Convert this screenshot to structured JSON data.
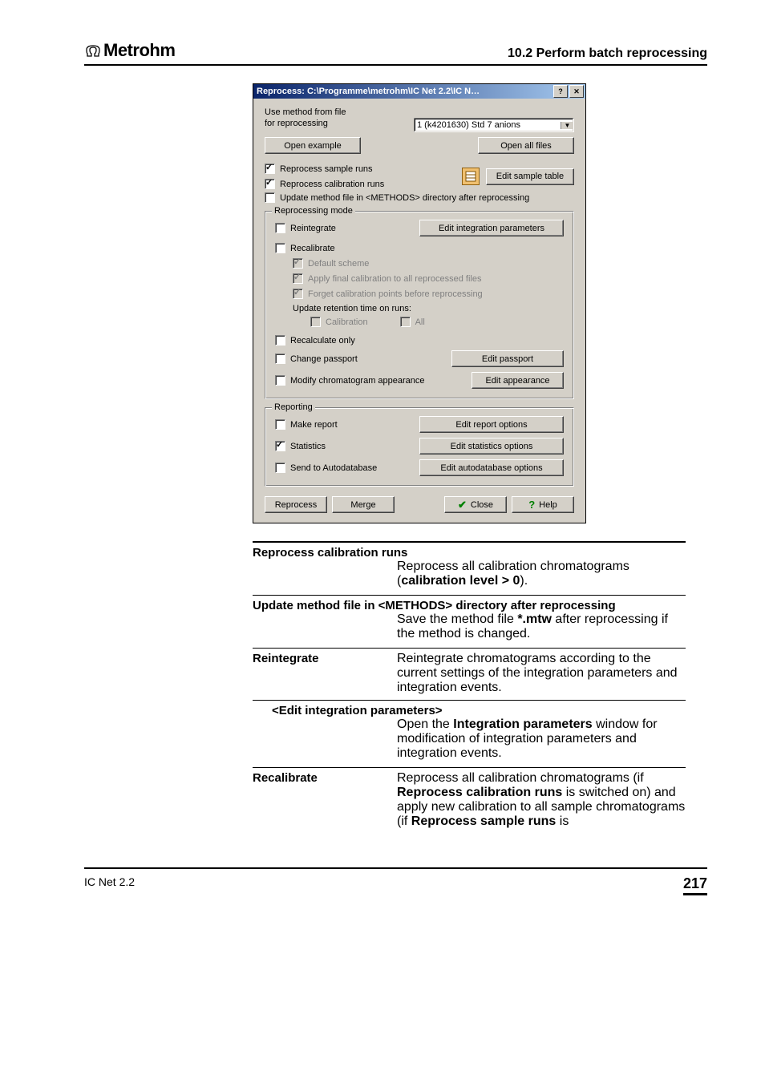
{
  "header": {
    "brand": "Metrohm",
    "section": "10.2  Perform batch reprocessing"
  },
  "dialog": {
    "title": "Reprocess: C:\\Programme\\metrohm\\IC Net 2.2\\IC N…",
    "use_method_label_1": "Use method from file",
    "use_method_label_2": "for reprocessing",
    "dropdown_value": "1  (k4201630)  Std 7 anions",
    "open_example": "Open example",
    "open_all_files": "Open all files",
    "reprocess_sample": "Reprocess sample runs",
    "reprocess_calibration": "Reprocess calibration runs",
    "edit_sample_table": "Edit sample table",
    "update_method": "Update method file in <METHODS> directory after reprocessing",
    "mode_group": "Reprocessing mode",
    "reintegrate": "Reintegrate",
    "edit_integ_params": "Edit integration parameters",
    "recalibrate": "Recalibrate",
    "default_scheme": "Default scheme",
    "apply_final": "Apply final calibration to all reprocessed files",
    "forget_points": "Forget calibration points before reprocessing",
    "update_retention": "Update retention time on runs:",
    "calibration": "Calibration",
    "all": "All",
    "recalculate_only": "Recalculate only",
    "change_passport": "Change passport",
    "edit_passport": "Edit passport",
    "modify_appearance": "Modify chromatogram appearance",
    "edit_appearance": "Edit appearance",
    "reporting_group": "Reporting",
    "make_report": "Make report",
    "edit_report_options": "Edit report options",
    "statistics": "Statistics",
    "edit_stat_options": "Edit statistics options",
    "send_autodb": "Send to Autodatabase",
    "edit_autodb": "Edit autodatabase options",
    "reprocess_btn": "Reprocess",
    "merge_btn": "Merge",
    "close_btn": "Close",
    "help_btn": "Help"
  },
  "doc": {
    "e1": {
      "term": "Reprocess calibration runs",
      "def_1": "Reprocess all calibration chromatograms (",
      "def_bold": "calibration level > 0",
      "def_2": ")."
    },
    "e2": {
      "term": "Update method file in <METHODS> directory after reprocessing",
      "def_1": "Save the method file ",
      "def_bold": "*.mtw",
      "def_2": " after reprocessing if the method is changed."
    },
    "e3": {
      "term": "Reintegrate",
      "def": "Reintegrate chromatograms according to the current settings of the integration parameters and integration events."
    },
    "e3b": {
      "term": "<Edit integration parameters>",
      "def_1": "Open the ",
      "def_bold": "Integration parameters",
      "def_2": " window for modification of integration parameters and integration events."
    },
    "e4": {
      "term": "Recalibrate",
      "def_1": "Reprocess all calibration chromatograms (if ",
      "def_bold1": "Reprocess calibration runs",
      "def_2": " is switched on) and apply new calibration to all sample chromatograms (if ",
      "def_bold2": "Reprocess sample runs",
      "def_3": " is"
    }
  },
  "footer": {
    "product": "IC Net 2.2",
    "page": "217"
  }
}
